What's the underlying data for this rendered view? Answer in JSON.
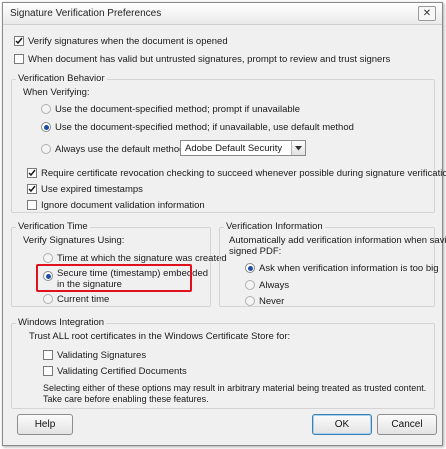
{
  "window": {
    "title": "Signature Verification Preferences",
    "close_glyph": "✕"
  },
  "top_options": {
    "verify_on_open": {
      "label": "Verify signatures when the document is opened",
      "checked": true
    },
    "untrusted_prompt": {
      "label": "When document has valid but untrusted signatures, prompt to review and trust signers",
      "checked": false
    }
  },
  "verification_behavior": {
    "title": "Verification Behavior",
    "when_verifying_label": "When Verifying:",
    "radios": [
      {
        "label": "Use the document-specified method; prompt if unavailable",
        "selected": false,
        "enabled": false
      },
      {
        "label": "Use the document-specified method; if unavailable, use default method",
        "selected": true,
        "enabled": true
      },
      {
        "label": "Always use the default method:",
        "selected": false,
        "enabled": false
      }
    ],
    "default_method": {
      "selected": "Adobe Default Security"
    },
    "checks": [
      {
        "label": "Require certificate revocation checking to succeed whenever possible during signature verification",
        "checked": true
      },
      {
        "label": "Use expired timestamps",
        "checked": true
      },
      {
        "label": "Ignore document validation information",
        "checked": false
      }
    ]
  },
  "verification_time": {
    "title": "Verification Time",
    "subtitle": "Verify Signatures Using:",
    "radios": [
      {
        "label": "Time at which the signature was created",
        "selected": false
      },
      {
        "label_line1": "Secure time (timestamp) embedded",
        "label_line2": "in the signature",
        "selected": true
      },
      {
        "label": "Current time",
        "selected": false
      }
    ]
  },
  "verification_information": {
    "title": "Verification Information",
    "desc_line1": "Automatically add verification information when saving",
    "desc_line2": "signed PDF:",
    "radios": [
      {
        "label": "Ask when verification information is too big",
        "selected": true
      },
      {
        "label": "Always",
        "selected": false
      },
      {
        "label": "Never",
        "selected": false
      }
    ]
  },
  "windows_integration": {
    "title": "Windows Integration",
    "trust_label": "Trust ALL root certificates in the Windows Certificate Store for:",
    "checks": [
      {
        "label": "Validating Signatures",
        "checked": false
      },
      {
        "label": "Validating Certified Documents",
        "checked": false
      }
    ],
    "warning_line1": "Selecting either of these options may result in arbitrary material being treated as trusted content.",
    "warning_line2": "Take care before enabling these features."
  },
  "buttons": {
    "help": "Help",
    "ok": "OK",
    "cancel": "Cancel"
  },
  "colors": {
    "highlight": "#e0101c",
    "radio_dot": "#1f4fa3"
  }
}
